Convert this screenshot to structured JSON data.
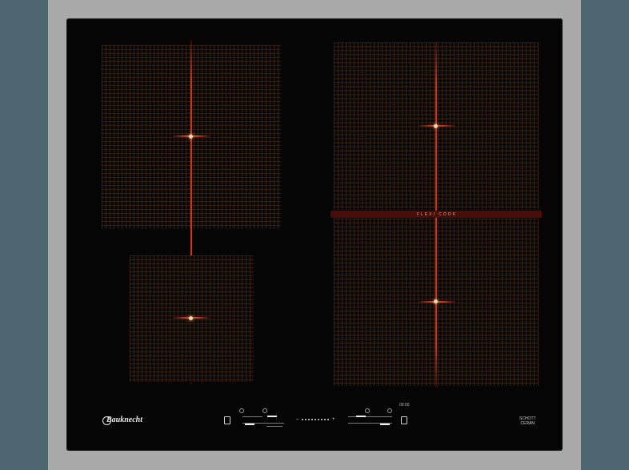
{
  "brand": {
    "name": "Bauknecht",
    "mark": "B"
  },
  "flexi_label": "FLEXI COOK",
  "glass_brand": {
    "line1": "SCHOTT",
    "line2": "CERAN"
  },
  "controls": {
    "minus": "–",
    "plus": "+",
    "timer_symbol": "00:00"
  },
  "colors": {
    "glass": "#050505",
    "heating_line": "#d7320f",
    "grid": "#6e4623",
    "frame": "#a9a9a9",
    "background": "#4e6670"
  }
}
